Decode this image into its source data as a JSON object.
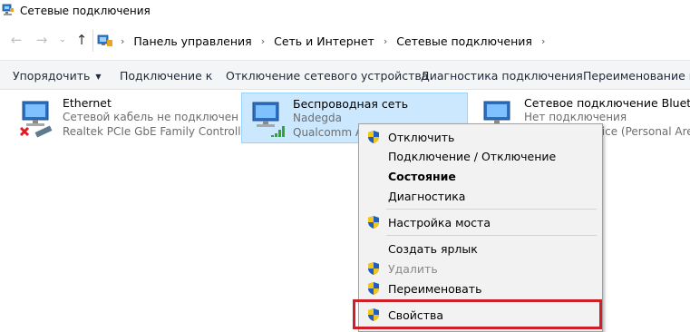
{
  "window": {
    "title": "Сетевые подключения",
    "icon": "network-connections-icon"
  },
  "addressbar": {
    "back_icon": "back-arrow-icon",
    "forward_icon": "forward-arrow-icon",
    "up_icon": "up-arrow-icon",
    "breadcrumbs": [
      "Панель управления",
      "Сеть и Интернет",
      "Сетевые подключения"
    ]
  },
  "commandbar": {
    "items": [
      "Упорядочить",
      "Подключение к",
      "Отключение сетевого устройства",
      "Диагностика подключения",
      "Переименование подключения"
    ]
  },
  "connections": [
    {
      "name": "Ethernet",
      "status": "Сетевой кабель не подключен",
      "adapter": "Realtek PCIe GbE Family Controller",
      "icon": "ethernet-disconnected-icon",
      "selected": false
    },
    {
      "name": "Беспроводная сеть",
      "status": "Nadegda",
      "adapter": "Qualcomm Atheros",
      "icon": "wireless-network-icon",
      "selected": true
    },
    {
      "name": "Сетевое подключение Bluetooth",
      "status": "Нет подключения",
      "adapter": "Bluetooth Device (Personal Area Network)",
      "icon": "bluetooth-network-icon",
      "selected": false
    }
  ],
  "context_menu": {
    "items": [
      {
        "label": "Отключить",
        "shield": true,
        "bold": false,
        "disabled": false
      },
      {
        "label": "Подключение / Отключение",
        "shield": false,
        "bold": false,
        "disabled": false
      },
      {
        "label": "Состояние",
        "shield": false,
        "bold": true,
        "disabled": false
      },
      {
        "label": "Диагностика",
        "shield": false,
        "bold": false,
        "disabled": false
      },
      {
        "label": "Настройка моста",
        "shield": true,
        "bold": false,
        "disabled": false
      },
      {
        "label": "Создать ярлык",
        "shield": false,
        "bold": false,
        "disabled": false
      },
      {
        "label": "Удалить",
        "shield": true,
        "bold": false,
        "disabled": true
      },
      {
        "label": "Переименовать",
        "shield": true,
        "bold": false,
        "disabled": false
      },
      {
        "label": "Свойства",
        "shield": true,
        "bold": false,
        "disabled": false
      }
    ],
    "highlighted_item": "Свойства",
    "highlight_color": "#d11f2a"
  }
}
